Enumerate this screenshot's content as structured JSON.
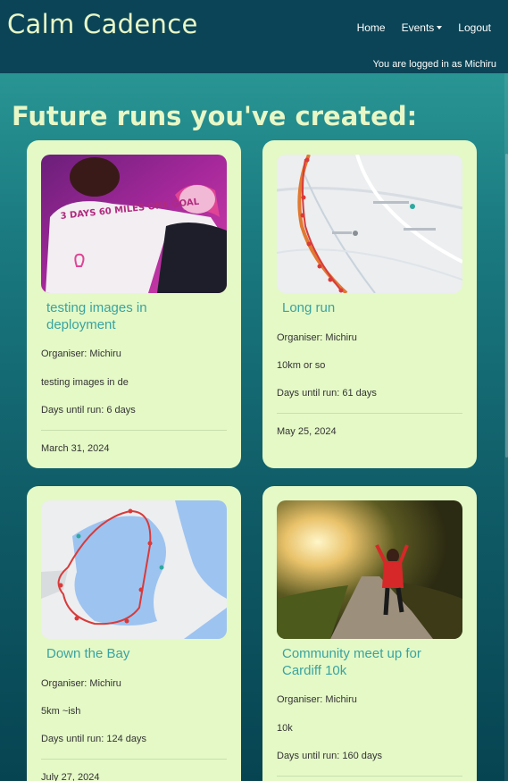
{
  "nav": {
    "brand": "Calm Cadence",
    "home": "Home",
    "events": "Events",
    "logout": "Logout",
    "logged_in": "You are logged in as Michiru"
  },
  "page_title": "Future runs you've created:",
  "cards": [
    {
      "title": "testing images in deployment",
      "organiser": "Organiser: Michiru",
      "description": "testing images in de",
      "days_until": "Days until run: 6 days",
      "date": "March 31, 2024",
      "image": "runners-pink-shirts-photo",
      "image_text": "3 DAYS 60 MILES ONE GOAL"
    },
    {
      "title": "Long run",
      "organiser": "Organiser: Michiru",
      "description": "10km or so",
      "days_until": "Days until run: 61 days",
      "date": "May 25, 2024",
      "image": "route-map"
    },
    {
      "title": "Down the Bay",
      "organiser": "Organiser: Michiru",
      "description": "5km ~ish",
      "days_until": "Days until run: 124 days",
      "date": "July 27, 2024",
      "image": "bay-route-map"
    },
    {
      "title": "Community meet up for Cardiff 10k",
      "organiser": "Organiser: Michiru",
      "description": "10k",
      "days_until": "Days until run: 160 days",
      "date": "",
      "image": "runner-sunlit-road-photo"
    }
  ],
  "colors": {
    "nav_bg": "#0b4456",
    "brand_text": "#e8f7c6",
    "card_bg": "#e4f9c6",
    "card_title": "#3aa3a0"
  }
}
